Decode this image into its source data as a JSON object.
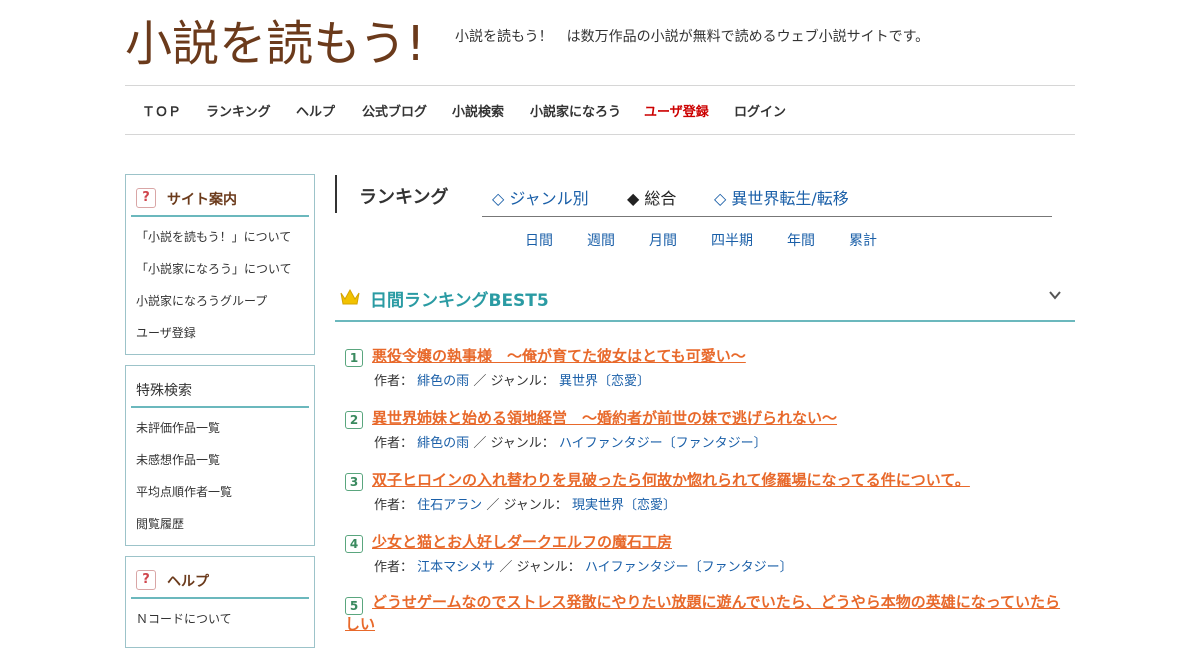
{
  "header": {
    "logo_text": "小説を読もう!",
    "tagline": "小説を読もう！　は数万作品の小説が無料で読めるウェブ小説サイトです。"
  },
  "nav": [
    {
      "label": "ＴＯＰ"
    },
    {
      "label": "ランキング"
    },
    {
      "label": "ヘルプ"
    },
    {
      "label": "公式ブログ"
    },
    {
      "label": "小説検索"
    },
    {
      "label": "小説家になろう"
    },
    {
      "label": "ユーザ登録"
    },
    {
      "label": "ログイン"
    }
  ],
  "sidebar": {
    "guide": {
      "title": "サイト案内",
      "items": [
        "「小説を読もう！」について",
        "「小説家になろう」について",
        "小説家になろうグループ",
        "ユーザ登録"
      ]
    },
    "special": {
      "title": "特殊検索",
      "items": [
        "未評価作品一覧",
        "未感想作品一覧",
        "平均点順作者一覧",
        "閲覧履歴"
      ]
    },
    "help": {
      "title": "ヘルプ",
      "items": [
        "Ｎコードについて"
      ]
    }
  },
  "ranking": {
    "title": "ランキング",
    "tabs": [
      "◇ ジャンル別",
      "◆ 総合",
      "◇ 異世界転生/転移"
    ],
    "periods": [
      "日間",
      "週間",
      "月間",
      "四半期",
      "年間",
      "累計"
    ],
    "best_label": "日間ランキングBEST5",
    "author_label": "作者：",
    "genre_sep": "／ ジャンル：",
    "items": [
      {
        "rank": "1",
        "title": "悪役令嬢の執事様　～俺が育てた彼女はとても可愛い～",
        "author": "緋色の雨",
        "genre": "異世界〔恋愛〕"
      },
      {
        "rank": "2",
        "title": "異世界姉妹と始める領地経営　～婚約者が前世の妹で逃げられない～",
        "author": "緋色の雨",
        "genre": "ハイファンタジー〔ファンタジー〕"
      },
      {
        "rank": "3",
        "title": "双子ヒロインの入れ替わりを見破ったら何故か惚れられて修羅場になってる件について。",
        "author": "住石アラン",
        "genre": "現実世界〔恋愛〕"
      },
      {
        "rank": "4",
        "title": "少女と猫とお人好しダークエルフの魔石工房",
        "author": "江本マシメサ",
        "genre": "ハイファンタジー〔ファンタジー〕"
      },
      {
        "rank": "5",
        "title": "どうせゲームなのでストレス発散にやりたい放題に遊んでいたら、どうやら本物の英雄になっていたらしい"
      }
    ]
  },
  "colors": {
    "accent_teal": "#6bb8bd",
    "title_orange": "#e8692b",
    "link_blue": "#1a5fa8",
    "register_red": "#cc0000",
    "logo_brown": "#6b3a1b"
  }
}
